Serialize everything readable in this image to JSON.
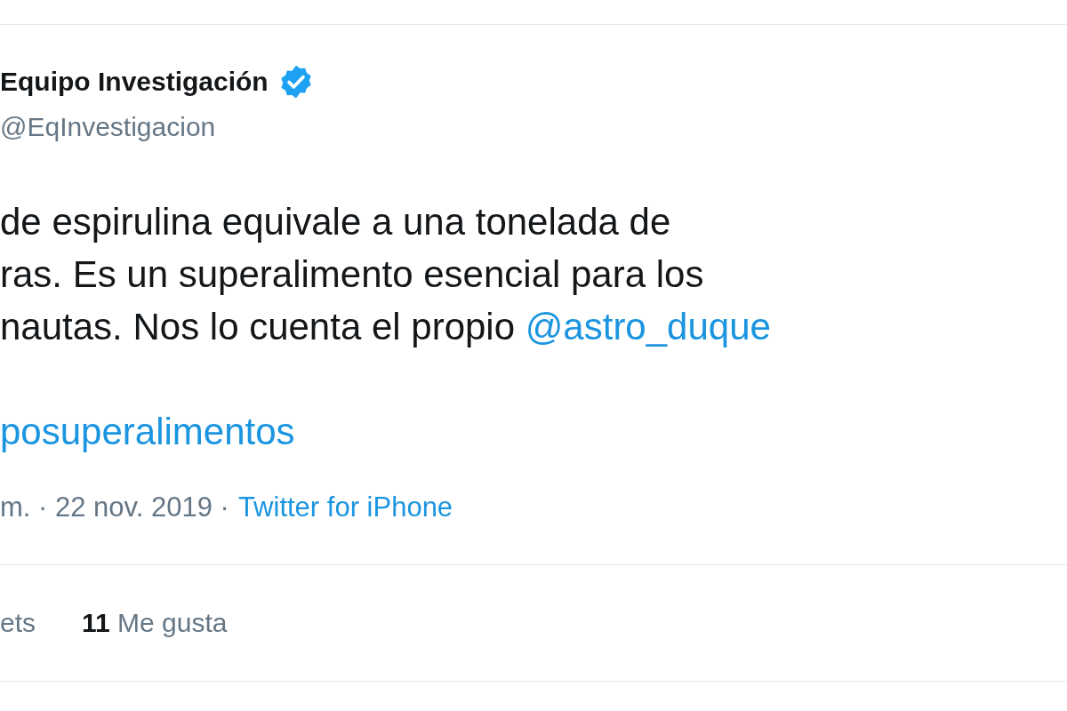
{
  "author": {
    "name": "Equipo Investigación",
    "verified": true,
    "handle": "@EqInvestigacion"
  },
  "tweet": {
    "lines": [
      {
        "text": "de espirulina equivale a una tonelada de"
      },
      {
        "text": "ras. Es un superalimento esencial para los"
      },
      {
        "text": "nautas. Nos lo cuenta el propio ",
        "mention": "@astro_duque"
      }
    ],
    "hashtag": "posuperalimentos"
  },
  "meta": {
    "timestamp": "m. · 22 nov. 2019 ·",
    "source": "Twitter for iPhone"
  },
  "stats": {
    "retweets_label": "ets",
    "likes_count": "11",
    "likes_label": "Me gusta"
  }
}
